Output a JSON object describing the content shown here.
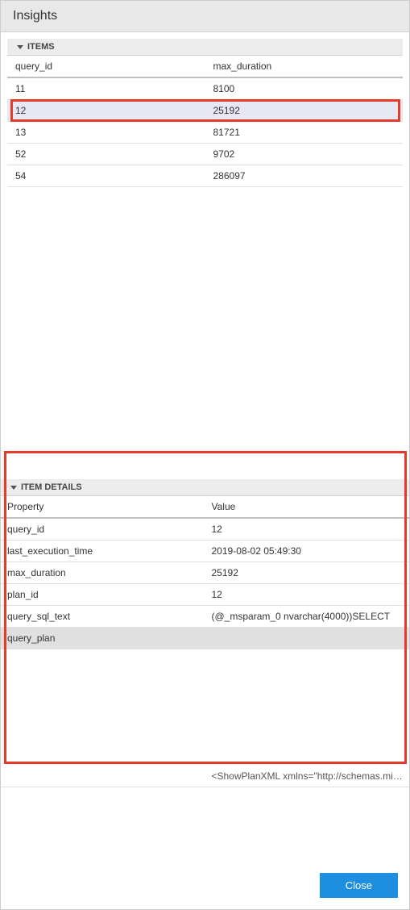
{
  "header": {
    "title": "Insights"
  },
  "items": {
    "section_label": "ITEMS",
    "columns": [
      "query_id",
      "max_duration"
    ],
    "rows": [
      {
        "query_id": "11",
        "max_duration": "8100"
      },
      {
        "query_id": "12",
        "max_duration": "25192"
      },
      {
        "query_id": "13",
        "max_duration": "81721"
      },
      {
        "query_id": "52",
        "max_duration": "9702"
      },
      {
        "query_id": "54",
        "max_duration": "286097"
      }
    ],
    "selected_index": 1
  },
  "details": {
    "section_label": "ITEM DETAILS",
    "columns": [
      "Property",
      "Value"
    ],
    "rows": [
      {
        "property": "query_id",
        "value": "12"
      },
      {
        "property": "last_execution_time",
        "value": "2019-08-02 05:49:30"
      },
      {
        "property": "max_duration",
        "value": "25192"
      },
      {
        "property": "plan_id",
        "value": "12"
      },
      {
        "property": "query_sql_text",
        "value": "(@_msparam_0 nvarchar(4000))SELECT"
      },
      {
        "property": "query_plan",
        "value": ""
      }
    ],
    "selected_detail_index": 5,
    "xml_value": "<ShowPlanXML xmlns=\"http://schemas.microsof..."
  },
  "footer": {
    "close_label": "Close"
  }
}
